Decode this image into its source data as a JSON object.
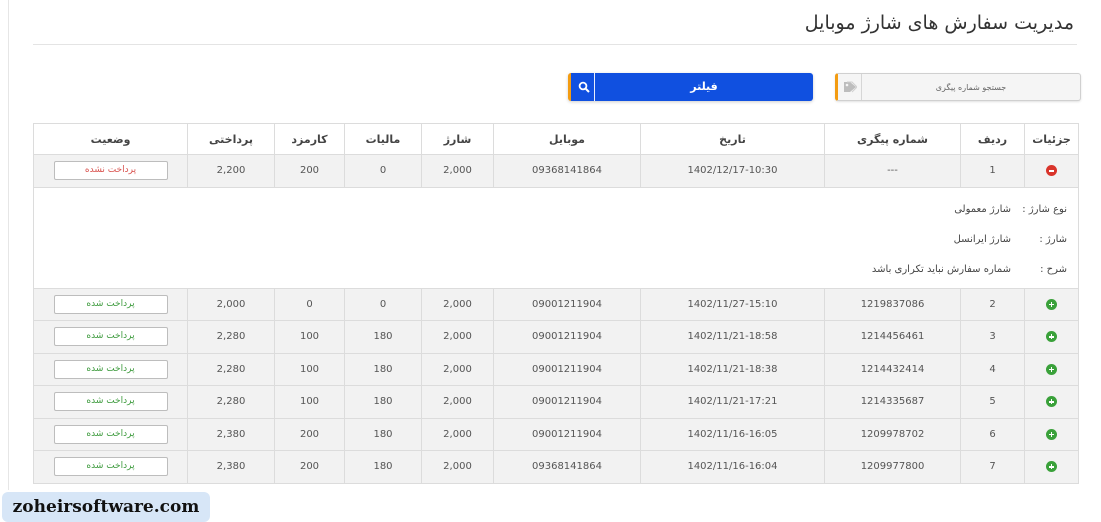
{
  "page": {
    "title": "مدیریت سفارش های شارژ موبایل"
  },
  "search": {
    "placeholder": "جستجو شماره پیگری",
    "icon": "tag-icon"
  },
  "filter": {
    "label": "فیلتر",
    "icon": "search-icon"
  },
  "table": {
    "headers": {
      "details": "جزئیات",
      "row": "ردیف",
      "tracking": "شماره پیگری",
      "date": "تاریخ",
      "mobile": "موبایل",
      "charge": "شارژ",
      "tax": "مالیات",
      "fee": "کارمزد",
      "payment": "پرداختی",
      "status": "وضعیت"
    },
    "expanded_row": {
      "row": "1",
      "tracking": "---",
      "date": "1402/12/17-10:30",
      "mobile": "09368141864",
      "charge": "2,000",
      "tax": "0",
      "fee": "200",
      "payment": "2,200",
      "status": "پرداخت نشده",
      "details": [
        {
          "label": "نوع شارژ :",
          "value": "شارژ معمولی"
        },
        {
          "label": "شارژ :",
          "value": "شارژ ایرانسل"
        },
        {
          "label": "شرح :",
          "value": "شماره سفارش نباید تکراری باشد"
        }
      ]
    },
    "rows": [
      {
        "row": "2",
        "tracking": "1219837086",
        "date": "1402/11/27-15:10",
        "mobile": "09001211904",
        "charge": "2,000",
        "tax": "0",
        "fee": "0",
        "payment": "2,000",
        "status": "پرداخت شده"
      },
      {
        "row": "3",
        "tracking": "1214456461",
        "date": "1402/11/21-18:58",
        "mobile": "09001211904",
        "charge": "2,000",
        "tax": "180",
        "fee": "100",
        "payment": "2,280",
        "status": "پرداخت شده"
      },
      {
        "row": "4",
        "tracking": "1214432414",
        "date": "1402/11/21-18:38",
        "mobile": "09001211904",
        "charge": "2,000",
        "tax": "180",
        "fee": "100",
        "payment": "2,280",
        "status": "پرداخت شده"
      },
      {
        "row": "5",
        "tracking": "1214335687",
        "date": "1402/11/21-17:21",
        "mobile": "09001211904",
        "charge": "2,000",
        "tax": "180",
        "fee": "100",
        "payment": "2,280",
        "status": "پرداخت شده"
      },
      {
        "row": "6",
        "tracking": "1209978702",
        "date": "1402/11/16-16:05",
        "mobile": "09001211904",
        "charge": "2,000",
        "tax": "180",
        "fee": "200",
        "payment": "2,380",
        "status": "پرداخت شده"
      },
      {
        "row": "7",
        "tracking": "1209977800",
        "date": "1402/11/16-16:04",
        "mobile": "09368141864",
        "charge": "2,000",
        "tax": "180",
        "fee": "200",
        "payment": "2,380",
        "status": "پرداخت شده"
      }
    ]
  },
  "watermark": "zoheirsoftware.com",
  "colors": {
    "accent": "#f39c12",
    "primary": "#1050e0",
    "red": "#d9534f",
    "green": "#3c9a3c",
    "blue": "#3b7ddd"
  }
}
